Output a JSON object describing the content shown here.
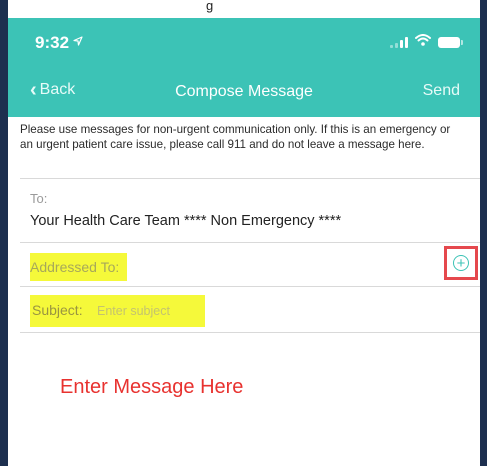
{
  "caption": {
    "fragment": "g"
  },
  "status_bar": {
    "time": "9:32",
    "location_icon": "location-arrow-icon",
    "signal_icon": "signal-icon",
    "wifi_icon": "wifi-icon",
    "battery_icon": "battery-icon"
  },
  "nav": {
    "back_label": "Back",
    "back_icon": "chevron-left-icon",
    "title": "Compose Message",
    "send_label": "Send"
  },
  "notice": "Please use messages for non-urgent communication only.  If this is an emergency or an urgent patient care issue, please call 911 and do not leave a message here.",
  "to": {
    "label": "To:",
    "value": "Your Health Care Team **** Non Emergency ****"
  },
  "addressed_to": {
    "label": "Addressed To:",
    "add_icon": "plus-circle-icon"
  },
  "subject": {
    "label": "Subject:",
    "placeholder": "Enter subject"
  },
  "message": {
    "hint": "Enter Message Here"
  },
  "colors": {
    "accent": "#3cc3b6",
    "highlight": "#f5f93a",
    "annotation_red": "#e5484d",
    "frame": "#1d2f4f"
  }
}
